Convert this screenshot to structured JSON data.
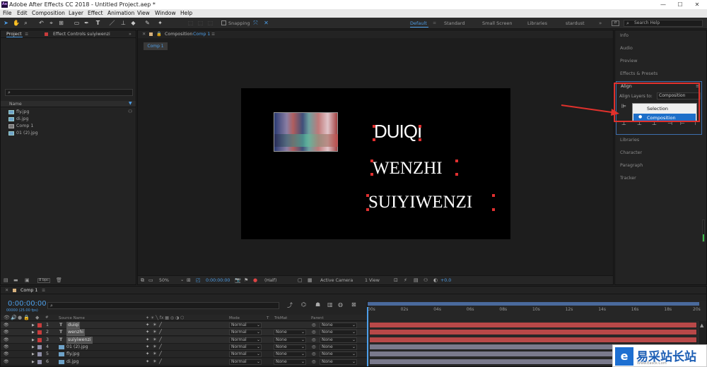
{
  "window": {
    "title": "Adobe After Effects CC 2018 - Untitled Project.aep *",
    "logo": "Ae",
    "min": "—",
    "max": "☐",
    "close": "✕"
  },
  "menu": [
    "File",
    "Edit",
    "Composition",
    "Layer",
    "Effect",
    "Animation",
    "View",
    "Window",
    "Help"
  ],
  "toolbar": {
    "snapping": "Snapping"
  },
  "workspaces": [
    "Default",
    "Standard",
    "Small Screen",
    "Libraries",
    "stardust"
  ],
  "search_help": "Search Help",
  "project": {
    "tab": "Project",
    "effect_tab": "Effect Controls suiyiwenzi",
    "search_placeholder": "",
    "col_name": "Name",
    "items": [
      "fly.jpg",
      "di.jpg",
      "Comp 1",
      "01 (2).jpg"
    ],
    "bpc": "8 bpc"
  },
  "comp": {
    "tab": "Composition",
    "tab_name": "Comp 1",
    "subtab": "Comp 1",
    "texts": [
      "DUIQI",
      "WENZHI",
      "SUIYIWENZI"
    ]
  },
  "viewer_bar": {
    "zoom": "50%",
    "time": "0:00:00:00",
    "res": "(Half)",
    "camera": "Active Camera",
    "views": "1 View",
    "exposure": "+0.0"
  },
  "right_panels": {
    "info": "Info",
    "audio": "Audio",
    "preview": "Preview",
    "effects": "Effects & Presets",
    "align": "Align",
    "align_to_label": "Align Layers to:",
    "align_to_value": "Composition",
    "options": [
      "Selection",
      "Composition"
    ],
    "libraries": "Libraries",
    "character": "Character",
    "paragraph": "Paragraph",
    "tracker": "Tracker"
  },
  "timeline": {
    "tab": "Comp 1",
    "timecode": "0:00:00:00",
    "fps": "00000 (25.00 fps)",
    "search_placeholder": "",
    "headers": {
      "source": "Source Name",
      "mode": "Mode",
      "t": "T",
      "trkmat": "TrkMat",
      "parent": "Parent"
    },
    "ruler": [
      "00s",
      "02s",
      "04s",
      "06s",
      "08s",
      "10s",
      "12s",
      "14s",
      "16s",
      "18s",
      "20s"
    ],
    "layers": [
      {
        "num": "1",
        "type": "T",
        "name": "duiqi",
        "mode": "Normal",
        "trkmat": "",
        "parent": "None",
        "color": "#c93c3c"
      },
      {
        "num": "2",
        "type": "T",
        "name": "wenzhi",
        "mode": "Normal",
        "trkmat": "None",
        "parent": "None",
        "color": "#c93c3c"
      },
      {
        "num": "3",
        "type": "T",
        "name": "suiyiwenzi",
        "mode": "Normal",
        "trkmat": "None",
        "parent": "None",
        "color": "#c93c3c"
      },
      {
        "num": "4",
        "type": "img",
        "name": "01 (2).jpg",
        "mode": "Normal",
        "trkmat": "None",
        "parent": "None",
        "color": "#8f8fa8"
      },
      {
        "num": "5",
        "type": "img",
        "name": "fly.jpg",
        "mode": "Normal",
        "trkmat": "None",
        "parent": "None",
        "color": "#8f8fa8"
      },
      {
        "num": "6",
        "type": "img",
        "name": "di.jpg",
        "mode": "Normal",
        "trkmat": "None",
        "parent": "None",
        "color": "#8f8fa8"
      }
    ]
  },
  "watermark": {
    "text": "易采站长站",
    "sub": "Www.Easck.Com"
  }
}
